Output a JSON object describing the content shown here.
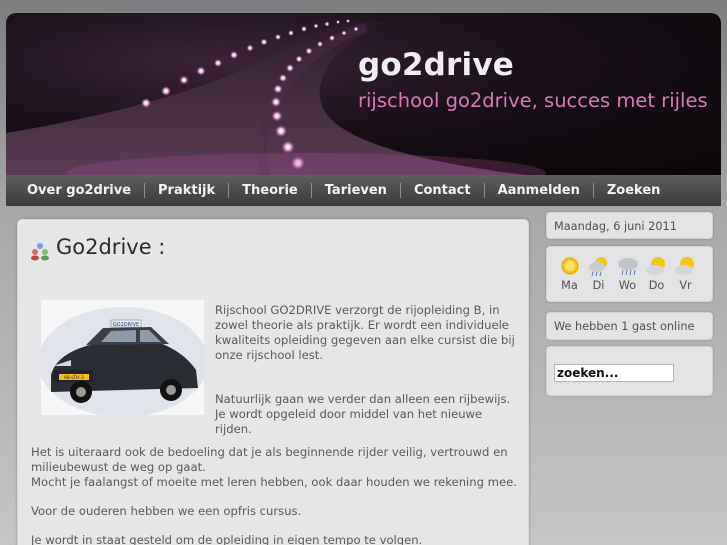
{
  "header": {
    "title": "go2drive",
    "tagline": "rijschool go2drive, succes met rijles"
  },
  "nav": {
    "items": [
      {
        "label": "Over go2drive"
      },
      {
        "label": "Praktijk"
      },
      {
        "label": "Theorie"
      },
      {
        "label": "Tarieven"
      },
      {
        "label": "Contact"
      },
      {
        "label": "Aanmelden"
      },
      {
        "label": "Zoeken"
      }
    ]
  },
  "article": {
    "title": "Go2drive :",
    "intro": [
      "Rijschool GO2DRIVE verzorgt de rijopleiding B, in zowel theorie als praktijk. Er wordt een individuele kwaliteits opleiding gegeven aan elke cursist die bij onze rijschool lest.",
      "Natuurlijk gaan we verder dan alleen een rijbewijs. Je wordt opgeleid door middel van het nieuwe rijden."
    ],
    "paragraph1_line1": "Het is uiteraard ook de bedoeling dat je als beginnende rijder veilig, vertrouwd en milieubewust de weg op gaat.",
    "paragraph1_line2": "Mocht je faalangst of moeite met leren hebben, ook daar houden we rekening mee.",
    "paragraph2": "Voor de ouderen hebben we een opfris cursus.",
    "paragraph3": "Je wordt in staat gesteld om de opleiding in eigen tempo te volgen.",
    "photo_plate": "68-LTH-3"
  },
  "sidebar": {
    "date": "Maandag, 6 juni 2011",
    "weather": [
      {
        "day": "Ma",
        "icon": "sun-icon"
      },
      {
        "day": "Di",
        "icon": "sun-rain-icon"
      },
      {
        "day": "Wo",
        "icon": "cloud-rain-icon"
      },
      {
        "day": "Do",
        "icon": "sun-cloud-icon"
      },
      {
        "day": "Vr",
        "icon": "sun-cloud-icon"
      }
    ],
    "guests": "We hebben 1 gast online",
    "search_value": "zoeken..."
  },
  "colors": {
    "tagline": "#d77ab9",
    "title": "#f1eef1",
    "nav_bg": "#4a4a4c",
    "content_bg": "#e6e6e8"
  }
}
